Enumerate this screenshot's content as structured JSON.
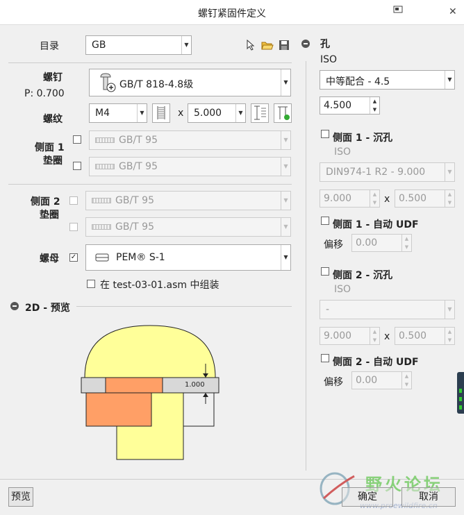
{
  "window": {
    "title": "螺钉紧固件定义"
  },
  "catalog": {
    "label": "目录",
    "value": "GB"
  },
  "screw": {
    "label": "螺钉",
    "pitch": "P: 0.700",
    "value": "GB/T 818-4.8级"
  },
  "thread": {
    "label": "螺纹",
    "size": "M4",
    "times": "x",
    "length": "5.000"
  },
  "side1": {
    "label_line1": "侧面 1",
    "label_line2": "垫圈",
    "washer1": "GB/T 95",
    "washer2": "GB/T 95"
  },
  "side2": {
    "label_line1": "侧面 2",
    "label_line2": "垫圈",
    "washer1": "GB/T 95",
    "washer2": "GB/T 95"
  },
  "nut": {
    "label": "螺母",
    "value": "PEM® S-1",
    "assemble_label": "在 test-03-01.asm 中组装"
  },
  "preview": {
    "title": "2D - 预览",
    "dimension": "1.000"
  },
  "hole": {
    "title": "孔",
    "standard": "ISO",
    "fit": "中等配合 - 4.5",
    "diameter": "4.500",
    "side1_cs": {
      "label": "侧面 1 - 沉孔",
      "standard": "ISO",
      "type": "DIN974-1 R2 - 9.000",
      "dia": "9.000",
      "times": "x",
      "depth": "0.500"
    },
    "side1_udf": {
      "label": "侧面 1 - 自动 UDF",
      "offset_label": "偏移",
      "offset": "0.00"
    },
    "side2_cs": {
      "label": "侧面 2 - 沉孔",
      "standard": "ISO",
      "type": "-",
      "dia": "9.000",
      "times": "x",
      "depth": "0.500"
    },
    "side2_udf": {
      "label": "侧面 2 - 自动 UDF",
      "offset_label": "偏移",
      "offset": "0.00"
    }
  },
  "buttons": {
    "preview": "预览",
    "ok": "确定",
    "cancel": "取消"
  },
  "watermark": {
    "text": "野火论坛",
    "url": "www.proewildfire.cn"
  }
}
